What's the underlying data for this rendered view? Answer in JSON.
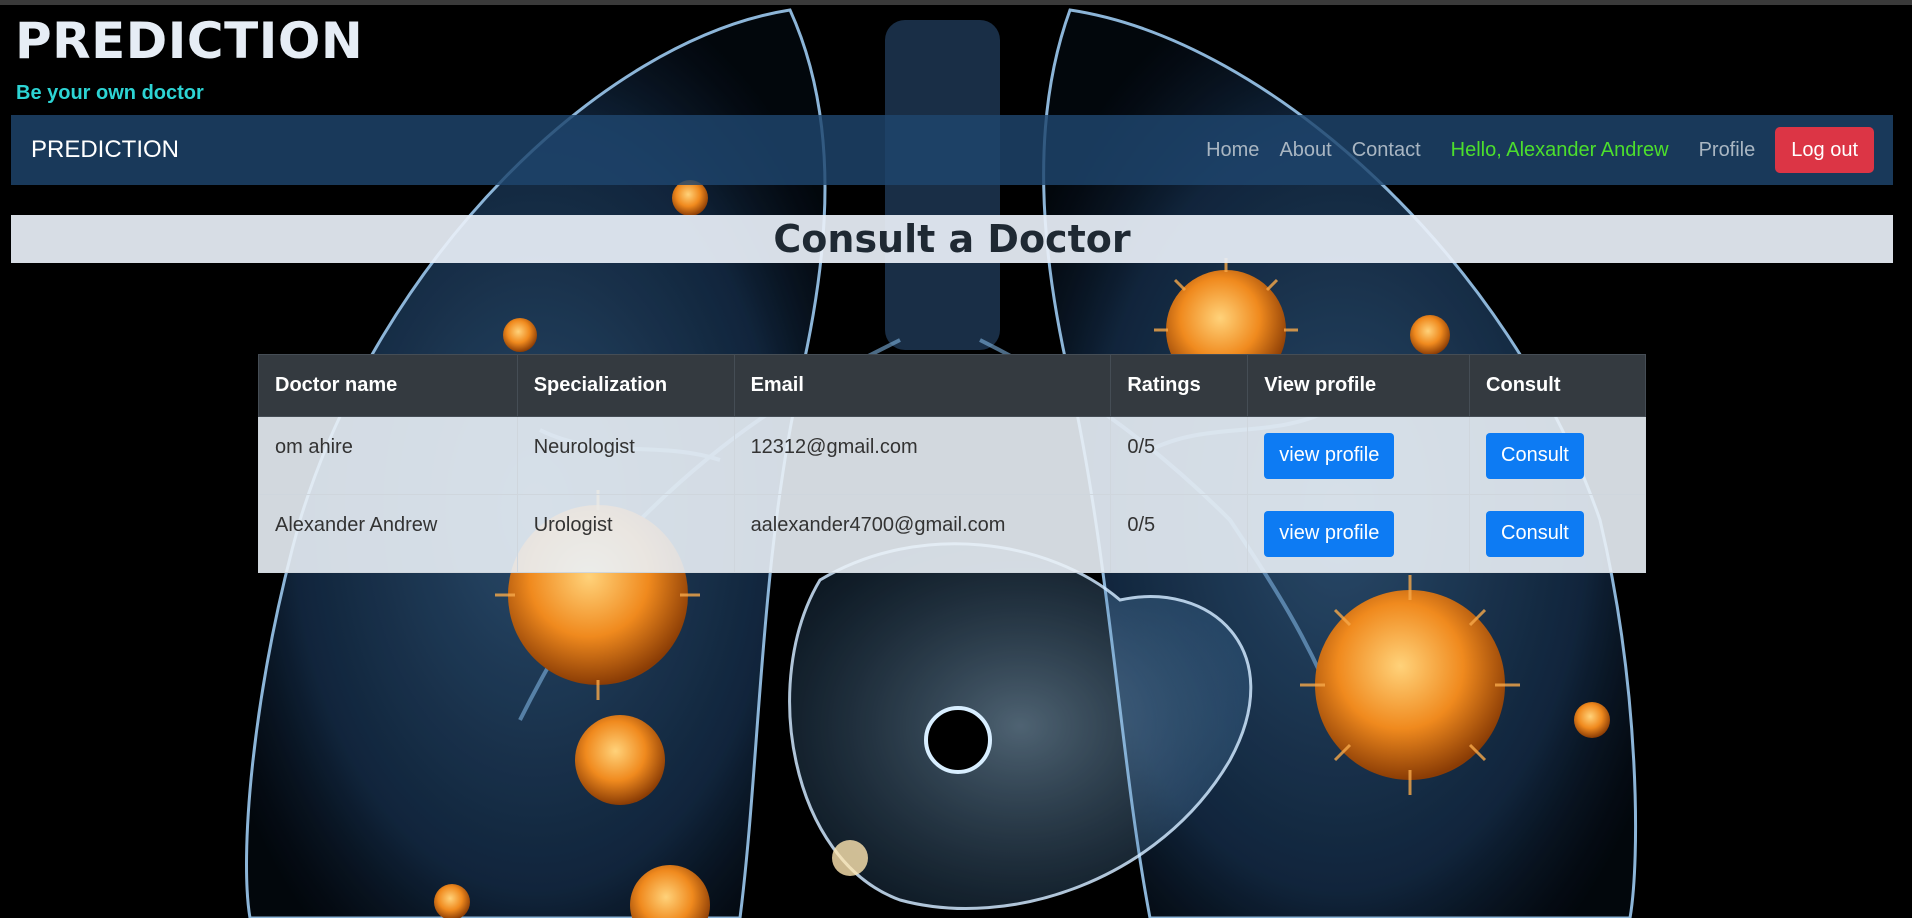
{
  "header": {
    "site_title": "PREDICTION",
    "tagline": "Be your own doctor"
  },
  "navbar": {
    "brand": "PREDICTION",
    "links": [
      "Home",
      "About",
      "Contact"
    ],
    "greeting": "Hello, Alexander Andrew",
    "profile_label": "Profile",
    "logout_label": "Log out"
  },
  "page": {
    "heading": "Consult a Doctor"
  },
  "table": {
    "columns": [
      "Doctor name",
      "Specialization",
      "Email",
      "Ratings",
      "View profile",
      "Consult"
    ],
    "rows": [
      {
        "name": "om ahire",
        "specialization": "Neurologist",
        "email": "12312@gmail.com",
        "rating": "0/5",
        "view_label": "view profile",
        "consult_label": "Consult"
      },
      {
        "name": "Alexander Andrew",
        "specialization": "Urologist",
        "email": "aalexander4700@gmail.com",
        "rating": "0/5",
        "view_label": "view profile",
        "consult_label": "Consult"
      }
    ]
  },
  "colors": {
    "navbar_bg": "#1e466e",
    "greeting": "#4cdf2c",
    "logout": "#dc3545",
    "primary_button": "#0d7bf3",
    "tagline": "#2dd4d4",
    "table_header": "#343a40"
  }
}
